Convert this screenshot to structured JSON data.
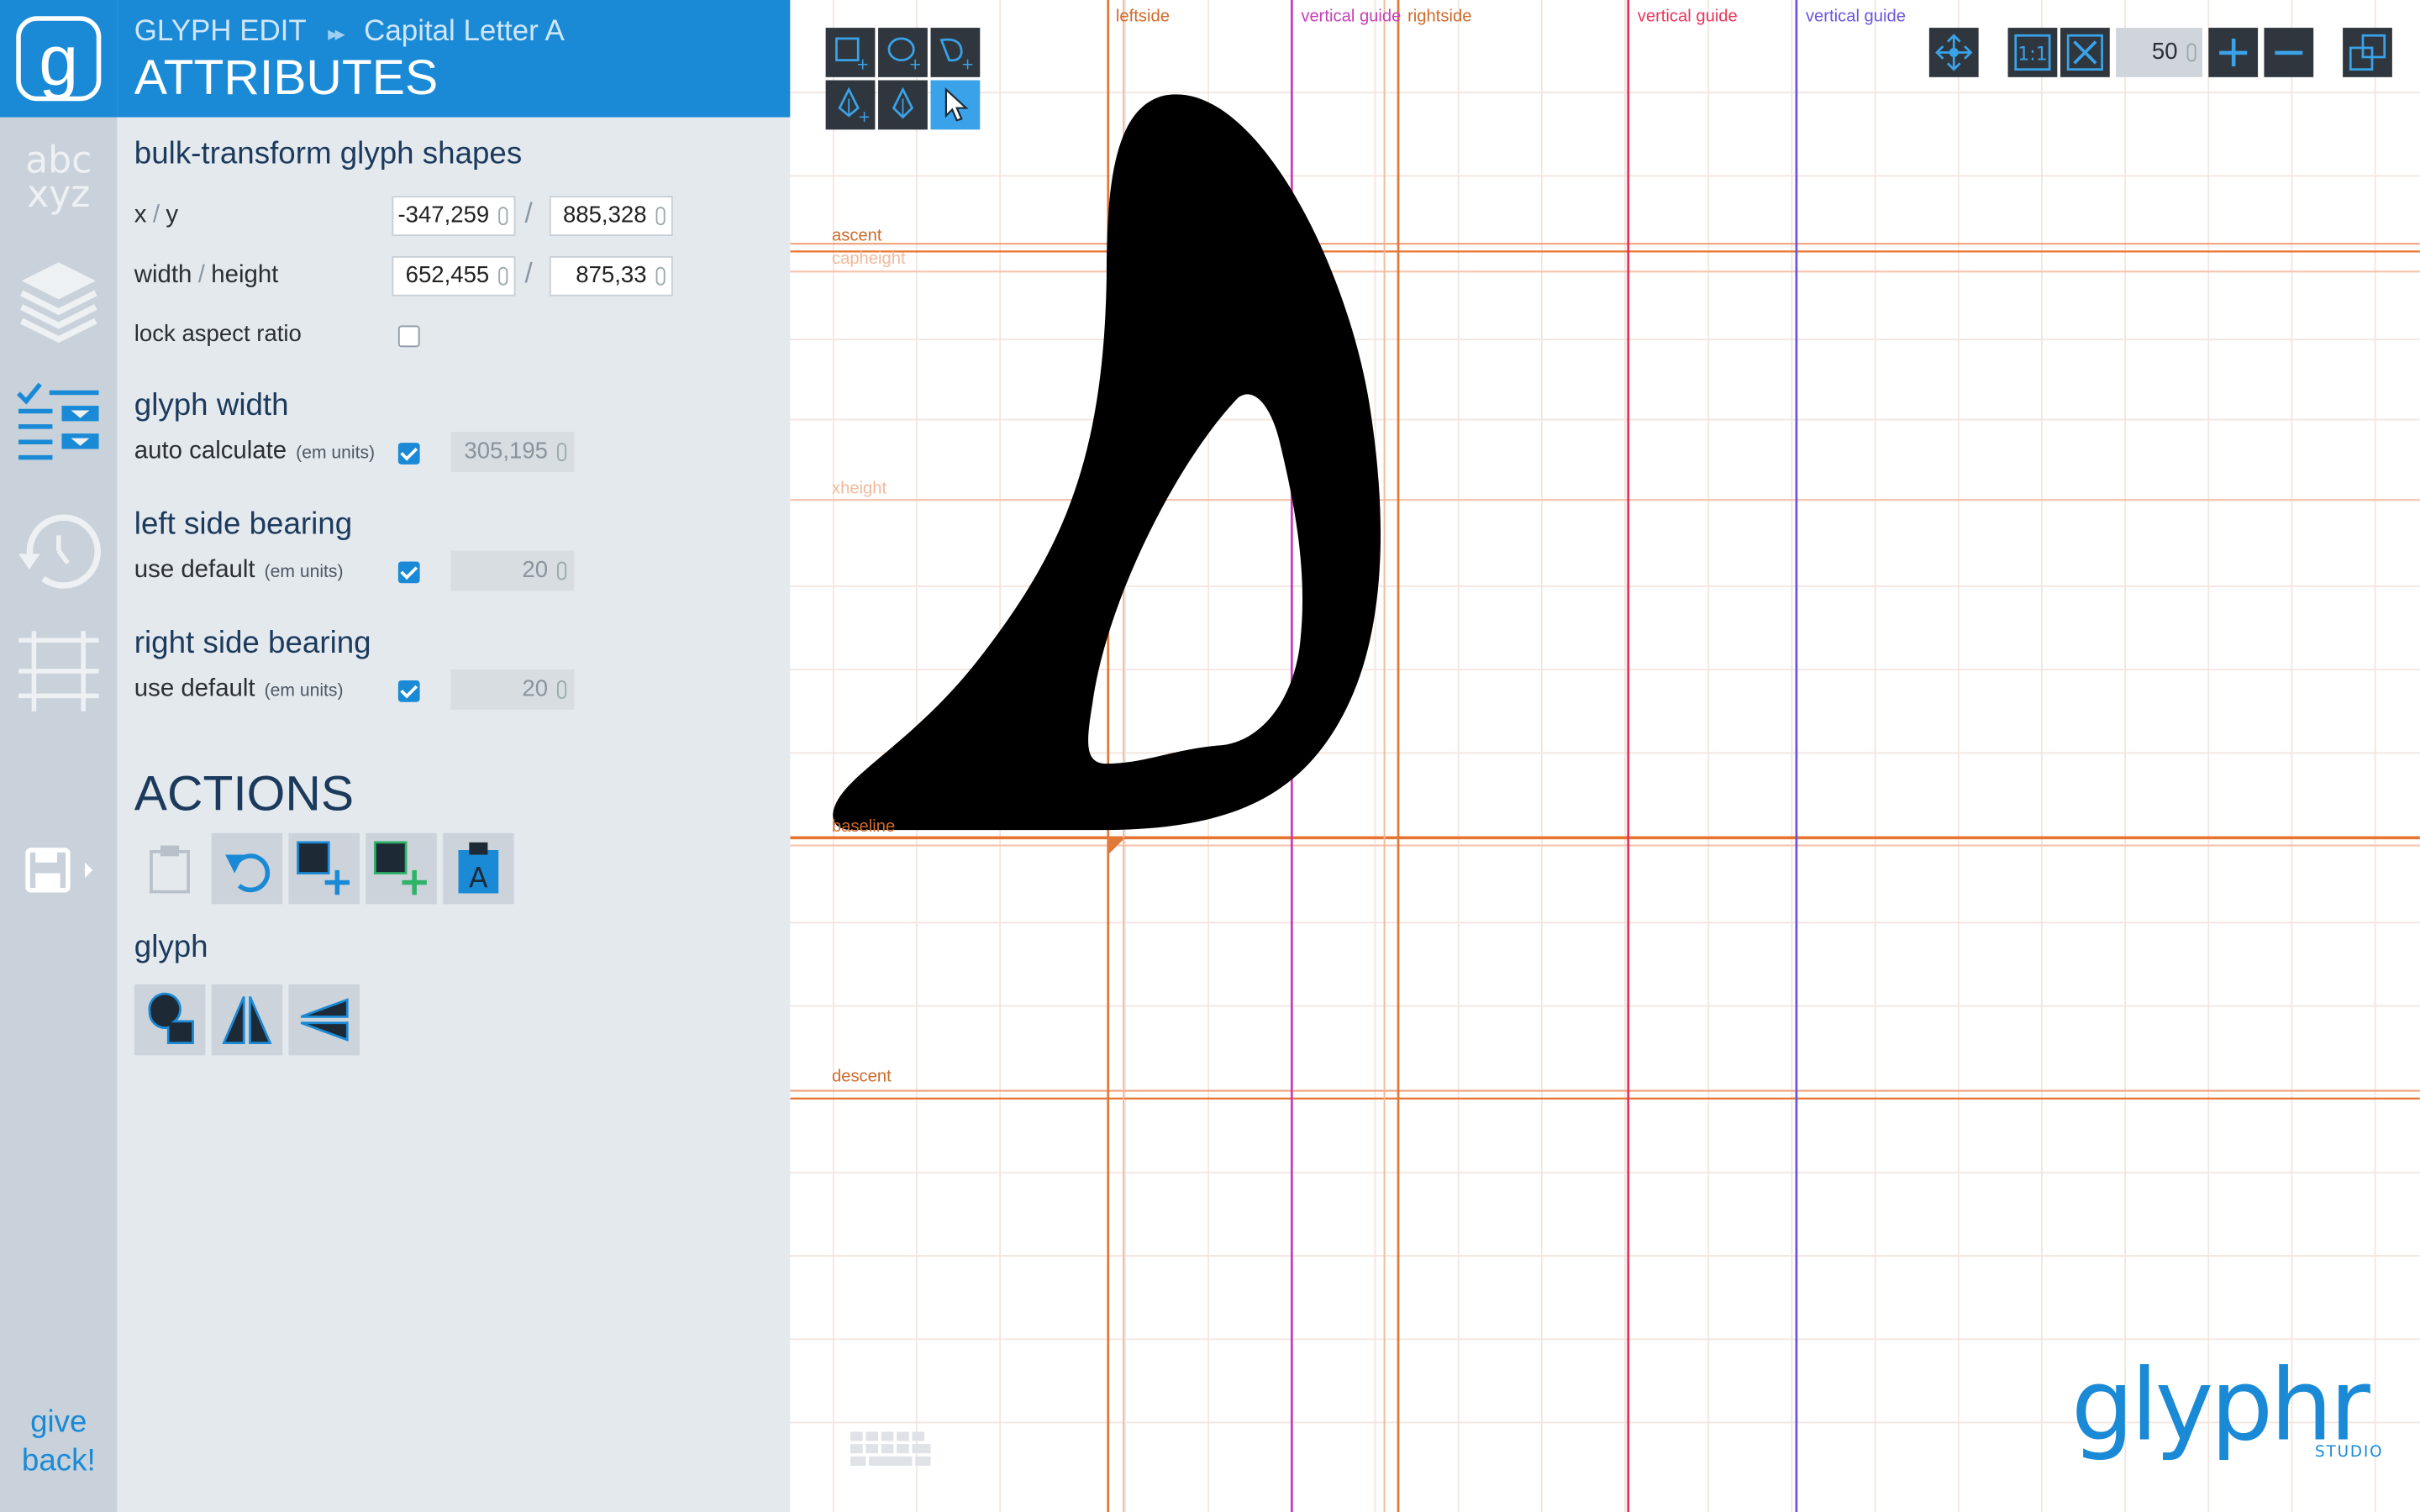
{
  "nav": {
    "logo_letter": "g",
    "give_back": [
      "give",
      "back!"
    ]
  },
  "header": {
    "app": "GLYPH EDIT",
    "crumb_sep": "▸▸",
    "glyph_name": "Capital Letter A",
    "title": "ATTRIBUTES"
  },
  "bulk": {
    "heading": "bulk-transform glyph shapes",
    "xy_label_x": "x",
    "xy_label_y": "y",
    "x_value": "-347,259",
    "y_value": "885,328",
    "wh_label_w": "width",
    "wh_label_h": "height",
    "width_value": "652,455",
    "height_value": "875,33",
    "slash": "/",
    "lock_label": "lock aspect ratio",
    "lock_checked": false
  },
  "glyph_width": {
    "heading": "glyph width",
    "label": "auto calculate",
    "units": "(em units)",
    "checked": true,
    "value": "305,195"
  },
  "lsb": {
    "heading": "left side bearing",
    "label": "use default",
    "units": "(em units)",
    "checked": true,
    "value": "20"
  },
  "rsb": {
    "heading": "right side bearing",
    "label": "use default",
    "units": "(em units)",
    "checked": true,
    "value": "20"
  },
  "actions": {
    "title": "ACTIONS",
    "glyph_label": "glyph"
  },
  "canvas": {
    "guide_labels": {
      "leftside": "leftside",
      "rightside": "rightside",
      "vertical_guide": "vertical guide",
      "ascent": "ascent",
      "capheight": "capheight",
      "xheight": "xheight",
      "baseline": "baseline",
      "descent": "descent"
    },
    "zoom_value": "50",
    "brand": "glyphr",
    "brand_sub": "STUDIO"
  },
  "colors": {
    "accent": "#1a8ad6",
    "guide_orange": "#e07a3a",
    "guide_magenta": "#c63fb8",
    "guide_red": "#e8345a",
    "guide_blue": "#6a55e0"
  }
}
